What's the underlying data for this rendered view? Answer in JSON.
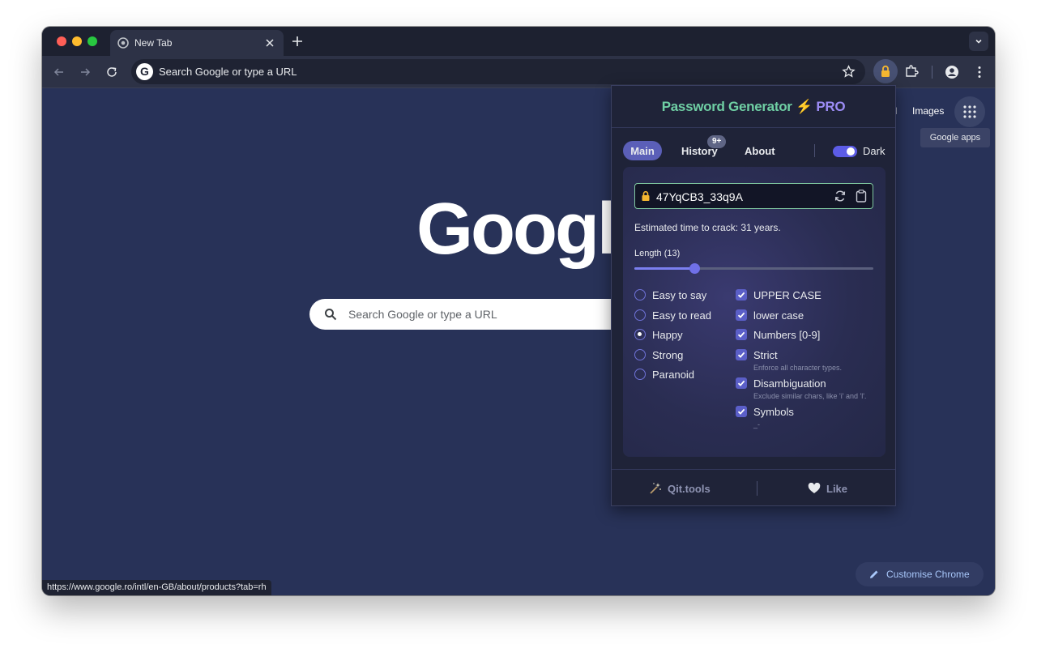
{
  "browser": {
    "tab_title": "New Tab",
    "address_placeholder": "Search Google or type a URL"
  },
  "ntp": {
    "gmail_partial": "il",
    "images_label": "Images",
    "apps_tooltip": "Google apps",
    "logo_text": "Google",
    "search_placeholder": "Search Google or type a URL",
    "customise_label": "Customise Chrome",
    "status_url": "https://www.google.ro/intl/en-GB/about/products?tab=rh"
  },
  "extension": {
    "title_part1": "Password Generator",
    "title_part2": "⚡ PRO",
    "tabs": {
      "main": "Main",
      "history": "History",
      "about": "About"
    },
    "history_badge": "9+",
    "dark_label": "Dark",
    "dark_enabled": true,
    "password": "47YqCB3_33q9A",
    "crack_text": "Estimated time to crack: 31 years.",
    "length_label": "Length (13)",
    "length_value": 13,
    "length_min": 4,
    "length_max": 40,
    "modes": [
      {
        "label": "Easy to say",
        "checked": false
      },
      {
        "label": "Easy to read",
        "checked": false
      },
      {
        "label": "Happy",
        "checked": true
      },
      {
        "label": "Strong",
        "checked": false
      },
      {
        "label": "Paranoid",
        "checked": false
      }
    ],
    "options": [
      {
        "label": "UPPER CASE",
        "checked": true,
        "sub": ""
      },
      {
        "label": "lower case",
        "checked": true,
        "sub": ""
      },
      {
        "label": "Numbers [0-9]",
        "checked": true,
        "sub": ""
      },
      {
        "label": "Strict",
        "checked": true,
        "sub": "Enforce all character types."
      },
      {
        "label": "Disambiguation",
        "checked": true,
        "sub": "Exclude similar chars, like 'i' and 'l'."
      },
      {
        "label": "Symbols",
        "checked": true,
        "sub": "_-"
      }
    ],
    "footer": {
      "qit": "Qit.tools",
      "like": "Like"
    }
  },
  "colors": {
    "title_green": "#6fcfa4",
    "title_purple": "#9c8cf5",
    "accent": "#5c5ce6",
    "ntp_background": "#283258"
  },
  "icons": {
    "lock": "lock-icon",
    "refresh": "refresh-icon",
    "clipboard": "clipboard-icon",
    "magic": "magic-wand-icon",
    "heart": "heart-icon"
  }
}
